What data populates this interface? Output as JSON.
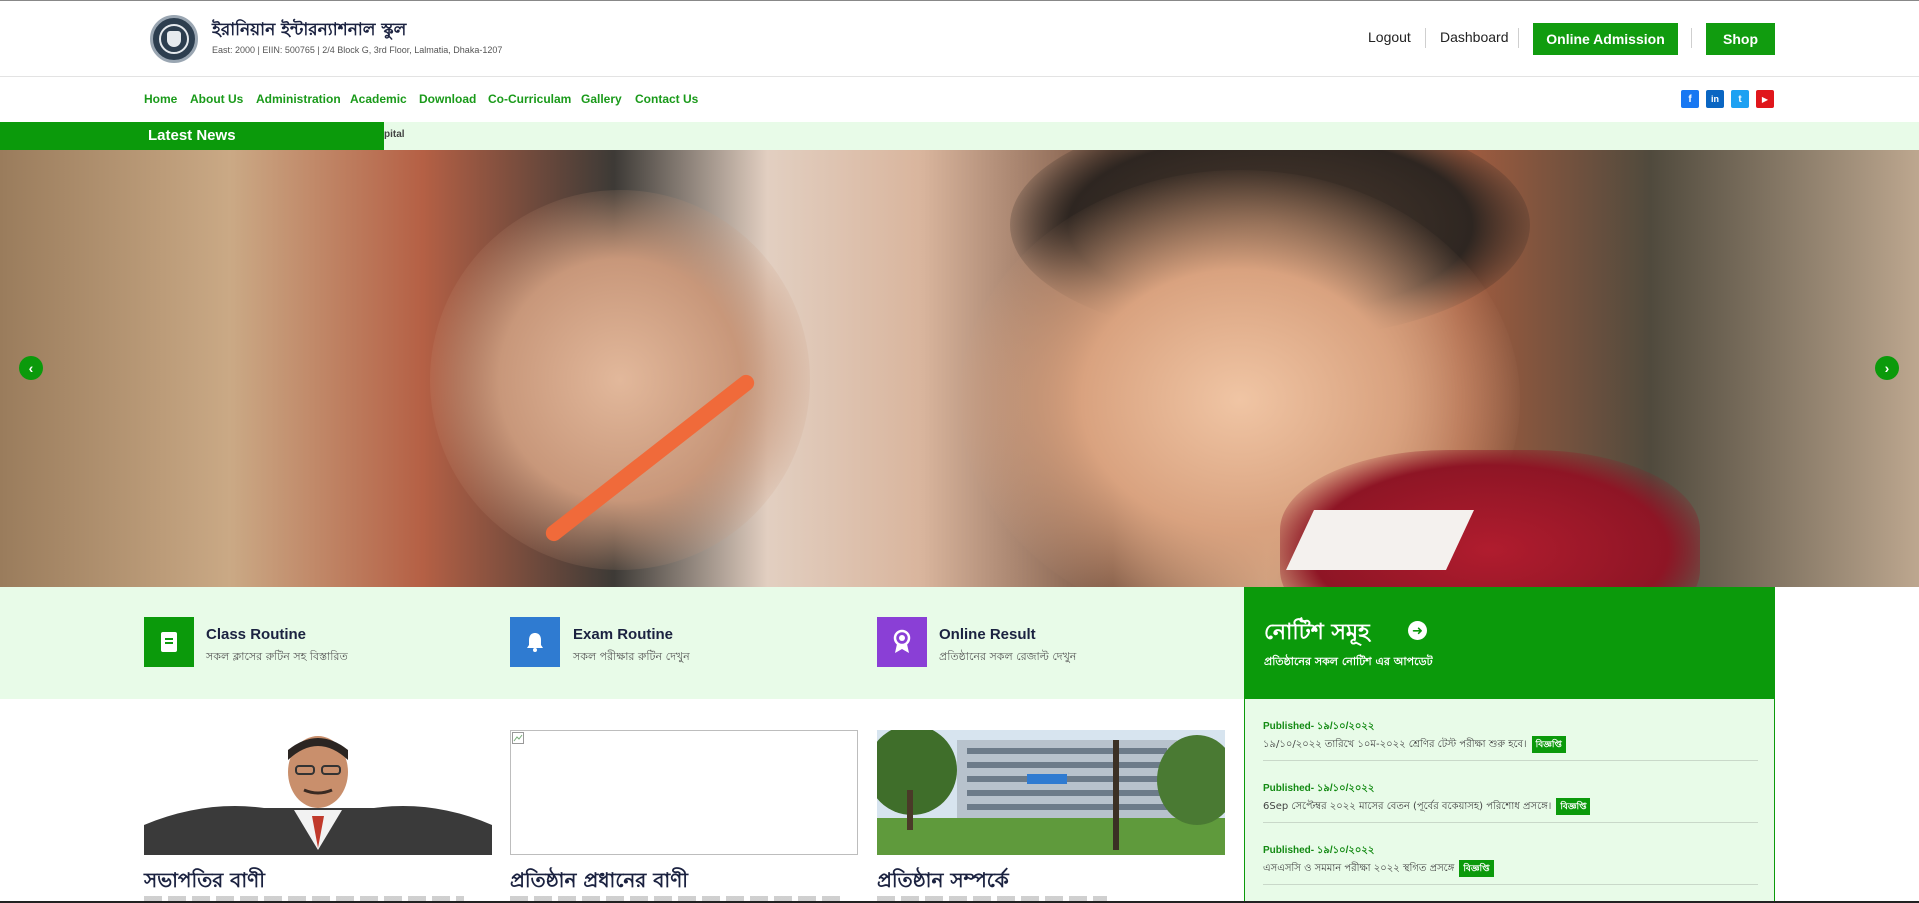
{
  "header": {
    "school_name": "ইরানিয়ান ইন্টারন্যাশনাল স্কুল",
    "school_info": "East: 2000 | EIIN: 500765 | 2/4 Block G, 3rd Floor, Lalmatia, Dhaka-1207",
    "logout": "Logout",
    "dashboard": "Dashboard",
    "online_admission": "Online Admission",
    "shop": "Shop"
  },
  "nav": {
    "items": [
      "Home",
      "About Us",
      "Administration",
      "Academic",
      "Download",
      "Co-Curriculam",
      "Gallery",
      "Contact Us"
    ],
    "social": [
      {
        "name": "facebook-icon",
        "glyph": "f",
        "color": "#1877f2"
      },
      {
        "name": "linkedin-icon",
        "glyph": "in",
        "color": "#0a66c2"
      },
      {
        "name": "twitter-icon",
        "glyph": "t",
        "color": "#1da1f2"
      },
      {
        "name": "youtube-icon",
        "glyph": "▶",
        "color": "#e0161b"
      }
    ]
  },
  "news": {
    "label": "Latest News",
    "ticker": "pital"
  },
  "hero": {
    "prev": "‹",
    "next": "›"
  },
  "quick_links": [
    {
      "title": "Class Routine",
      "subtitle": "সকল ক্লাসের রুটিন সহ বিস্তারিত",
      "color": "#0b9a0b",
      "icon": "book-icon"
    },
    {
      "title": "Exam Routine",
      "subtitle": "সকল পরীক্ষার রুটিন দেখুন",
      "color": "#2f7bd1",
      "icon": "bell-icon"
    },
    {
      "title": "Online Result",
      "subtitle": "প্রতিষ্ঠানের সকল রেজাল্ট দেখুন",
      "color": "#8a3fd6",
      "icon": "award-icon"
    }
  ],
  "notice": {
    "title": "নোটিশ সমূহ",
    "subtitle": "প্রতিষ্ঠানের সকল নোটিশ এর আপডেট",
    "items": [
      {
        "published": "Published- ১৯/১০/২০২২",
        "text": "১৯/১০/২০২২ তারিখে ১০ম-২০২২ শ্রেণির টেস্ট পরীক্ষা শুরু হবে।",
        "tag": "বিজ্ঞপ্তি"
      },
      {
        "published": "Published- ১৯/১০/২০২২",
        "text": "6Sep সেপ্টেম্বর ২০২২ মাসের বেতন (পূর্বের বকেয়াসহ) পরিশোধ প্রসঙ্গে।",
        "tag": "বিজ্ঞপ্তি"
      },
      {
        "published": "Published- ১৯/১০/২০২২",
        "text": "এসএসসি ও সমমান পরীক্ষা ২০২২ স্থগিত প্রসঙ্গে",
        "tag": "বিজ্ঞপ্তি"
      }
    ]
  },
  "cards": [
    {
      "title": "সভাপতির বাণী"
    },
    {
      "title": "প্রতিষ্ঠান প্রধানের বাণী"
    },
    {
      "title": "প্রতিষ্ঠান সম্পর্কে"
    }
  ]
}
